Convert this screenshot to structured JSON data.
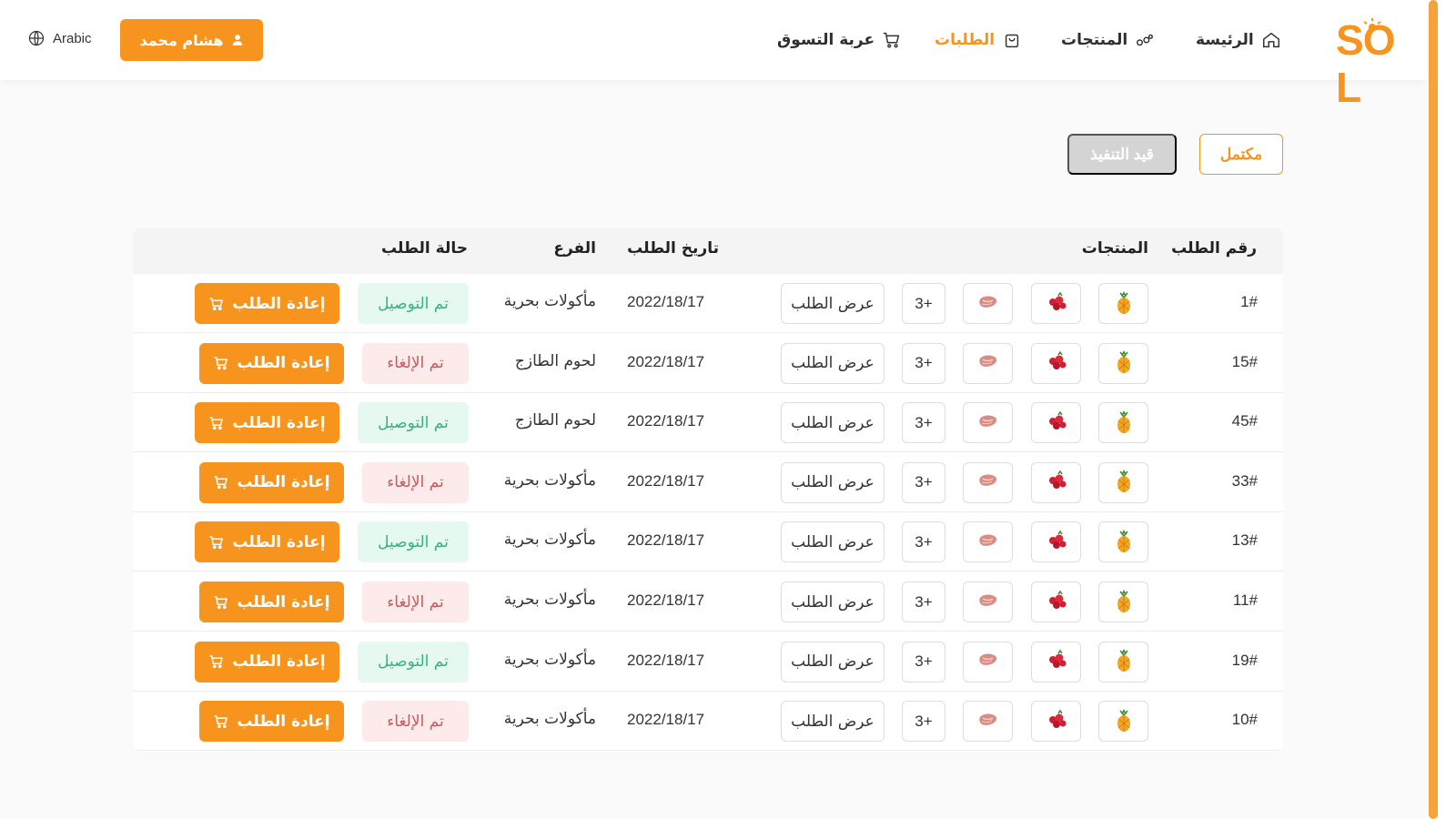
{
  "header": {
    "logo": "SŌL",
    "nav": [
      {
        "label": "الرئيسة",
        "icon": "home-icon",
        "active": false
      },
      {
        "label": "المنتجات",
        "icon": "products-icon",
        "active": false
      },
      {
        "label": "الطلبات",
        "icon": "orders-bag-icon",
        "active": true
      },
      {
        "label": "عربة التسوق",
        "icon": "cart-icon",
        "active": false
      }
    ],
    "user_name": "هشام محمد",
    "language": "Arabic"
  },
  "filters": {
    "complete": "مكتمل",
    "in_progress": "قيد التنفيذ"
  },
  "table": {
    "headers": {
      "order_number": "رقم الطلب",
      "products": "المنتجات",
      "order_date": "تاريخ الطلب",
      "branch": "الفرع",
      "status": "حالة الطلب"
    },
    "more_label": "3+",
    "view_label": "عرض الطلب",
    "reorder_label": "إعادة الطلب",
    "rows": [
      {
        "number": "1#",
        "date": "2022/18/17",
        "branch": "مأكولات بحرية",
        "status": "تم التوصيل",
        "status_type": "delivered"
      },
      {
        "number": "15#",
        "date": "2022/18/17",
        "branch": "لحوم الطازج",
        "status": "تم الإلغاء",
        "status_type": "cancelled"
      },
      {
        "number": "45#",
        "date": "2022/18/17",
        "branch": "لحوم الطازج",
        "status": "تم التوصيل",
        "status_type": "delivered"
      },
      {
        "number": "33#",
        "date": "2022/18/17",
        "branch": "مأكولات بحرية",
        "status": "تم الإلغاء",
        "status_type": "cancelled"
      },
      {
        "number": "13#",
        "date": "2022/18/17",
        "branch": "مأكولات بحرية",
        "status": "تم التوصيل",
        "status_type": "delivered"
      },
      {
        "number": "11#",
        "date": "2022/18/17",
        "branch": "مأكولات بحرية",
        "status": "تم الإلغاء",
        "status_type": "cancelled"
      },
      {
        "number": "19#",
        "date": "2022/18/17",
        "branch": "مأكولات بحرية",
        "status": "تم التوصيل",
        "status_type": "delivered"
      },
      {
        "number": "10#",
        "date": "2022/18/17",
        "branch": "مأكولات بحرية",
        "status": "تم الإلغاء",
        "status_type": "cancelled"
      }
    ],
    "product_icons": [
      "pineapple-icon",
      "raspberry-icon",
      "meat-icon"
    ]
  },
  "colors": {
    "accent": "#f7941d",
    "delivered_bg": "#e6f9f1",
    "delivered_text": "#37b27a",
    "cancelled_bg": "#fdeaea",
    "cancelled_text": "#c75a5a"
  }
}
